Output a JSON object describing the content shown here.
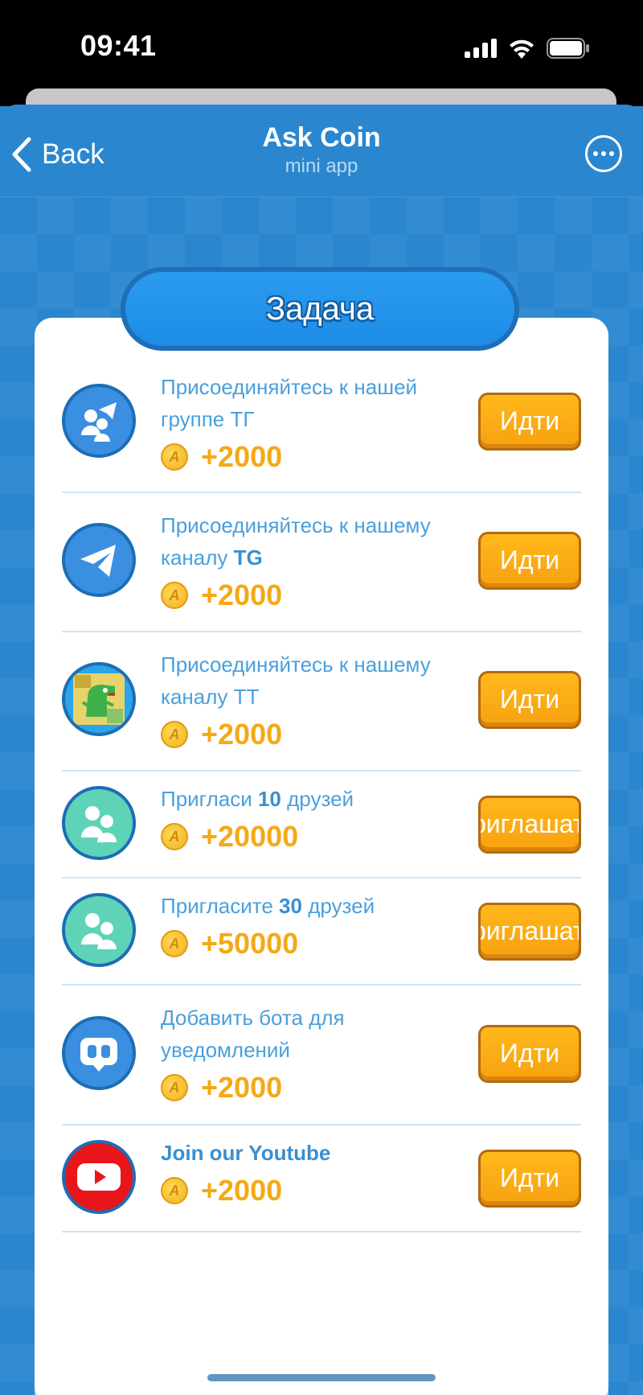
{
  "status_bar": {
    "time": "09:41"
  },
  "header": {
    "back_label": "Back",
    "title": "Ask Coin",
    "subtitle": "mini app"
  },
  "banner": {
    "title": "Задача"
  },
  "colors": {
    "accent": "#2a87cf",
    "button": "#f7a10f",
    "reward": "#f4a915",
    "title_text": "#4a9fdc"
  },
  "tasks": [
    {
      "title_pre": "Присоединяйтесь к нашей группе ТГ",
      "title_bold": "",
      "title_post": "",
      "reward": "+2000",
      "button": "Идти",
      "icon": "group-telegram-icon"
    },
    {
      "title_pre": "Присоединяйтесь к нашему каналу ",
      "title_bold": "TG",
      "title_post": "",
      "reward": "+2000",
      "button": "Идти",
      "icon": "telegram-icon"
    },
    {
      "title_pre": "Присоединяйтесь к нашему каналу ТТ",
      "title_bold": "",
      "title_post": "",
      "reward": "+2000",
      "button": "Идти",
      "icon": "dinosaur-icon"
    },
    {
      "title_pre": "Пригласи ",
      "title_bold": "10",
      "title_post": " друзей",
      "reward": "+20000",
      "button": "Приглашать",
      "icon": "friends-icon"
    },
    {
      "title_pre": "Пригласите ",
      "title_bold": "30",
      "title_post": " друзей",
      "reward": "+50000",
      "button": "Приглашать",
      "icon": "friends-icon"
    },
    {
      "title_pre": "Добавить бота для уведомлений",
      "title_bold": "",
      "title_post": "",
      "reward": "+2000",
      "button": "Идти",
      "icon": "bot-icon"
    },
    {
      "title_pre": "",
      "title_bold": "Join our Youtube",
      "title_post": "",
      "reward": "+2000",
      "button": "Идти",
      "icon": "youtube-icon"
    }
  ]
}
